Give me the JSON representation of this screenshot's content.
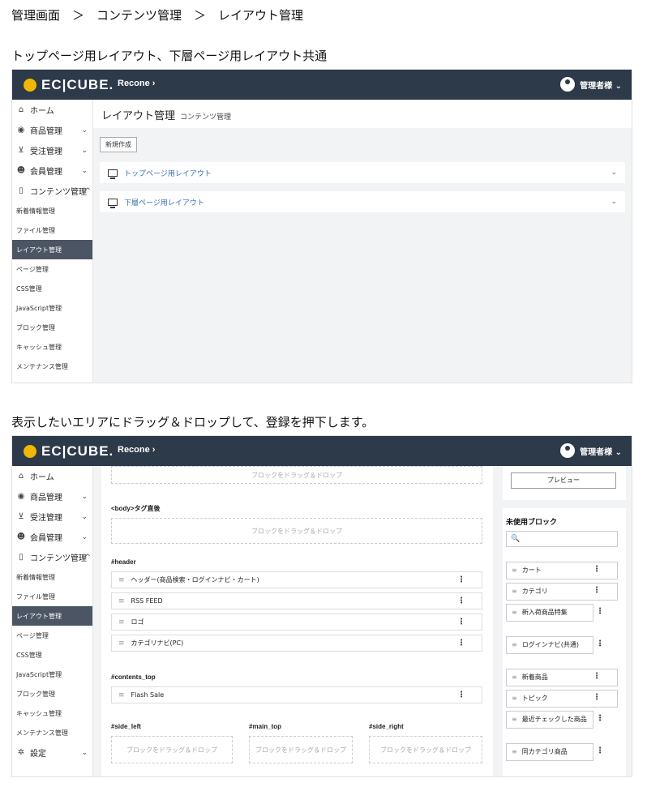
{
  "breadcrumb": "管理画面　＞　コンテンツ管理　＞　レイアウト管理",
  "section1_caption": "トップページ用レイアウト、下層ページ用レイアウト共通",
  "section2_caption": "表示したいエリアにドラッグ＆ドロップして、登録を押下します。",
  "header": {
    "logo": "EC|CUBE.",
    "shop_name": "Recone ›",
    "user": "管理者様 ⌄"
  },
  "sidebar": {
    "home": "ホーム",
    "products": "商品管理",
    "orders": "受注管理",
    "customers": "会員管理",
    "contents": "コンテンツ管理",
    "sub": [
      "新着情報管理",
      "ファイル管理",
      "レイアウト管理",
      "ページ管理",
      "CSS管理",
      "JavaScript管理",
      "ブロック管理",
      "キャッシュ管理",
      "メンテナンス管理"
    ],
    "settings": "設定"
  },
  "screen1": {
    "page_title": "レイアウト管理",
    "page_subtitle": "コンテンツ管理",
    "new_button": "新規作成",
    "layouts": [
      "トップページ用レイアウト",
      "下層ページ用レイアウト"
    ]
  },
  "screen2": {
    "drop_text": "ブロックをドラッグ＆ドロップ",
    "zones": {
      "body_after": "<body>タグ直後",
      "header": "#header",
      "contents_top": "#contents_top",
      "side_left": "#side_left",
      "main_top": "#main_top",
      "side_right": "#side_right"
    },
    "header_blocks": [
      "ヘッダー(商品検索・ログインナビ・カート)",
      "RSS FEED",
      "ロゴ",
      "カテゴリナビ(PC)"
    ],
    "contents_top_blocks": [
      "Flash Sale"
    ],
    "preview_button": "プレビュー",
    "unused_title": "未使用ブロック",
    "unused_blocks": [
      "カート",
      "カテゴリ",
      "新入荷商品特集",
      "ログインナビ(共通)",
      "新着商品",
      "トピック",
      "最近チェックした商品",
      "同カテゴリ商品"
    ]
  }
}
